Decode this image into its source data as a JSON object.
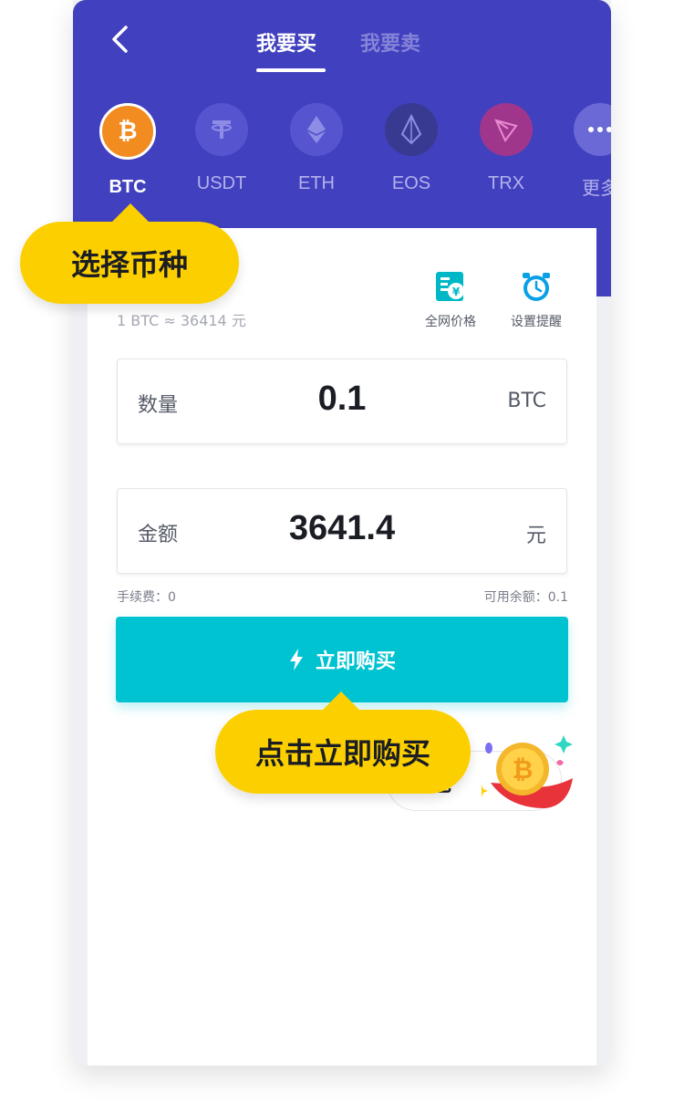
{
  "header": {
    "tab_buy": "我要买",
    "tab_sell": "我要卖"
  },
  "coins": [
    {
      "label": "BTC",
      "icon": "bitcoin-icon",
      "active": true
    },
    {
      "label": "USDT",
      "icon": "tether-icon"
    },
    {
      "label": "ETH",
      "icon": "ethereum-icon"
    },
    {
      "label": "EOS",
      "icon": "eos-icon"
    },
    {
      "label": "TRX",
      "icon": "tron-icon"
    },
    {
      "label": "更多",
      "icon": "more-icon"
    }
  ],
  "rate_text": "1 BTC ≈ 36414 元",
  "tools": {
    "network_price": "全网价格",
    "set_alert": "设置提醒"
  },
  "quantity": {
    "label": "数量",
    "value": "0.1",
    "unit": "BTC"
  },
  "amount": {
    "label": "金额",
    "value": "3641.4",
    "unit": "元"
  },
  "fee_text": "手续费：0",
  "balance_text": "可用余额：0.1",
  "buy_button": "立即购买",
  "pill_text": "包",
  "tooltips": {
    "select_coin": "选择币种",
    "click_buy": "点击立即购买"
  },
  "colors": {
    "header": "#4140bf",
    "accent": "#00c3d2",
    "tooltip": "#fcd000",
    "btc": "#f28b20"
  }
}
